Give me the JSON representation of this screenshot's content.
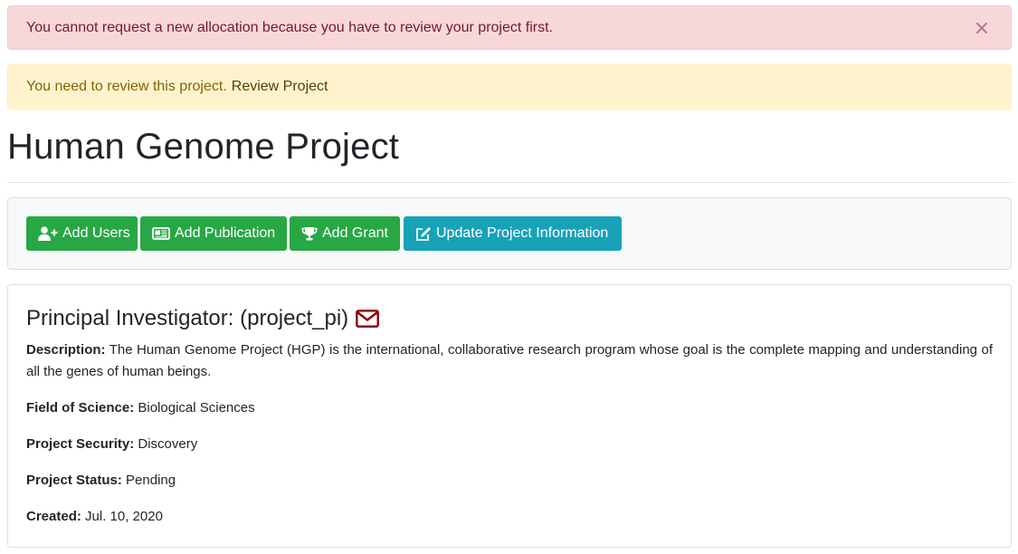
{
  "alerts": {
    "danger": {
      "message": "You cannot request a new allocation because you have to review your project first.",
      "close_symbol": "×"
    },
    "warning": {
      "message": "You need to review this project.",
      "link_label": "Review Project"
    }
  },
  "project": {
    "title": "Human Genome Project"
  },
  "toolbar": {
    "add_users_label": "Add Users",
    "add_publication_label": "Add Publication",
    "add_grant_label": "Add Grant",
    "update_info_label": "Update Project Information"
  },
  "details": {
    "pi_heading": "Principal Investigator: (project_pi)",
    "description_label": "Description:",
    "description_value": "The Human Genome Project (HGP) is the international, collaborative research program whose goal is the complete mapping and understanding of all the genes of human beings.",
    "field_of_science_label": "Field of Science:",
    "field_of_science_value": "Biological Sciences",
    "security_label": "Project Security:",
    "security_value": "Discovery",
    "status_label": "Project Status:",
    "status_value": "Pending",
    "created_label": "Created:",
    "created_value": "Jul. 10, 2020"
  },
  "colors": {
    "danger_bg": "#f8d7da",
    "warning_bg": "#fff3cd",
    "success": "#28a745",
    "info": "#17a2b8",
    "mail_icon": "#8b0000"
  },
  "icons": {
    "close": "close-icon",
    "add_users": "user-plus-icon",
    "add_publication": "newspaper-icon",
    "add_grant": "trophy-icon",
    "update_info": "edit-icon",
    "mail": "envelope-icon"
  }
}
